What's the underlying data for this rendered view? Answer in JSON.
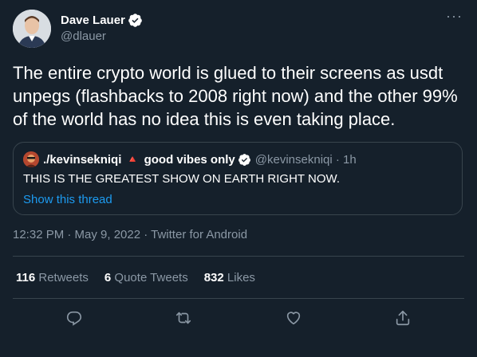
{
  "author": {
    "display_name": "Dave Lauer",
    "handle": "@dlauer",
    "verified_icon": "verified-badge-icon"
  },
  "tweet": {
    "text": "The entire crypto world is glued to their screens as usdt unpegs (flashbacks to 2008 right now) and the other 99% of the world has no idea this is even taking place."
  },
  "quote": {
    "name": "./kevinsekniqi",
    "triangle": "🔺",
    "name_suffix": "good vibes only",
    "handle_time": "@kevinsekniqi · 1h",
    "text": "THIS IS THE GREATEST SHOW ON EARTH RIGHT NOW.",
    "thread_link": "Show this thread"
  },
  "meta": {
    "timestamp": "12:32 PM · May 9, 2022 · Twitter for Android"
  },
  "stats": {
    "retweets_count": "116",
    "retweets_label": "Retweets",
    "quotes_count": "6",
    "quotes_label": "Quote Tweets",
    "likes_count": "832",
    "likes_label": "Likes"
  },
  "more_menu": "···",
  "colors": {
    "background": "#15202b",
    "link": "#1d9bf0",
    "muted": "#8b98a5",
    "border": "#38444d",
    "verified": "#ffffff"
  },
  "actions": [
    "reply-icon",
    "retweet-icon",
    "like-icon",
    "share-icon"
  ]
}
